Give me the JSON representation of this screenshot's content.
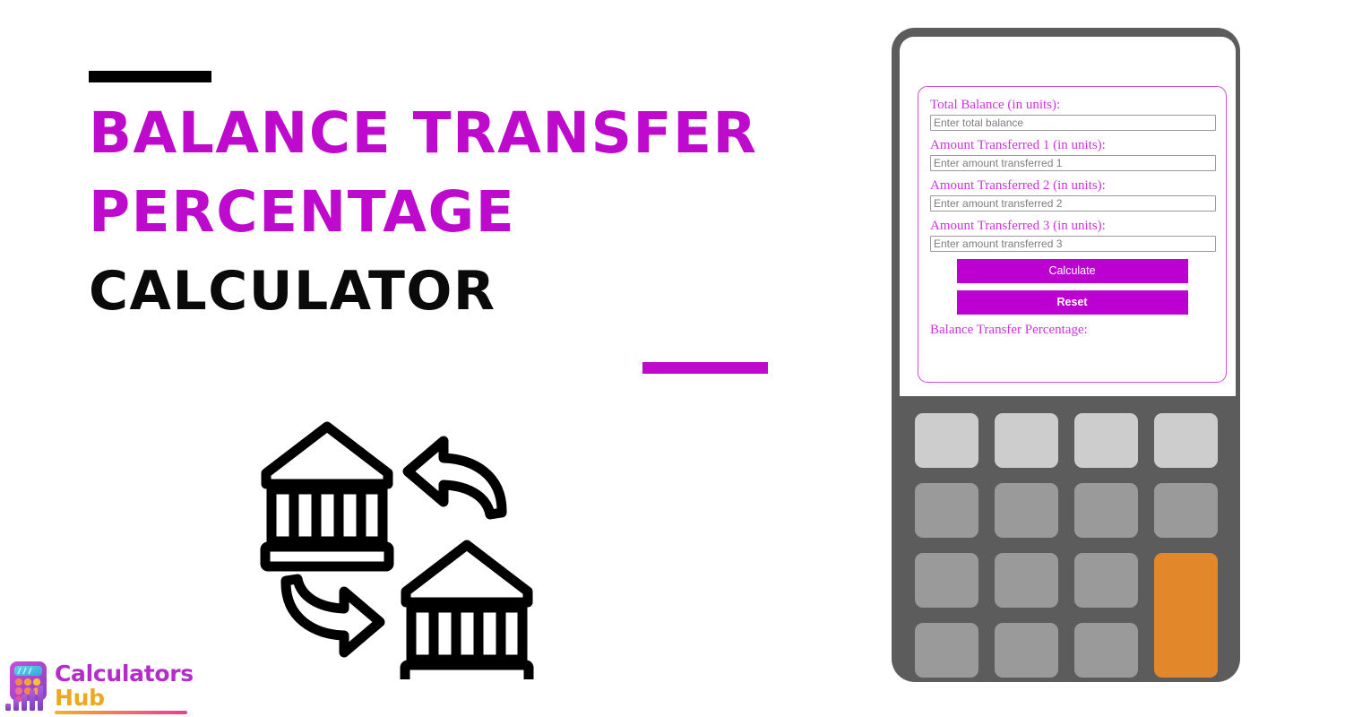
{
  "hero": {
    "title_lines": [
      {
        "text": "BALANCE TRANSFER",
        "color_class": "magenta"
      },
      {
        "text": "PERCENTAGE",
        "color_class": "magenta"
      },
      {
        "text": "CALCULATOR",
        "color_class": "black"
      }
    ],
    "accent_bar_top_color": "#000000",
    "accent_bar_bottom_color": "#bd0acd",
    "illustration_name": "bank-transfer-illustration"
  },
  "brand": {
    "word_1": "Calculators",
    "word_2": "Hub",
    "word_1_color": "#b32ec9",
    "word_2_color": "#eda820",
    "logo_icon": "calculator-bar-chart-icon"
  },
  "calculator": {
    "device_color": "#5c5c5c",
    "accent_color": "#bd00d2",
    "fields": [
      {
        "label": "Total Balance (in units):",
        "placeholder": "Enter total balance",
        "value": "",
        "name": "total-balance-field"
      },
      {
        "label": "Amount Transferred 1 (in units):",
        "placeholder": "Enter amount transferred 1",
        "value": "",
        "name": "amount-transferred-1-field"
      },
      {
        "label": "Amount Transferred 2 (in units):",
        "placeholder": "Enter amount transferred 2",
        "value": "",
        "name": "amount-transferred-2-field"
      },
      {
        "label": "Amount Transferred 3 (in units):",
        "placeholder": "Enter amount transferred 3",
        "value": "",
        "name": "amount-transferred-3-field"
      }
    ],
    "calculate_label": "Calculate",
    "reset_label": "Reset",
    "result_label": "Balance Transfer Percentage:",
    "result_value": "",
    "keypad": {
      "rows": [
        [
          "light",
          "light",
          "light",
          "light"
        ],
        [
          "medium",
          "medium",
          "medium",
          "medium"
        ],
        [
          "medium",
          "medium",
          "medium",
          "accent"
        ],
        [
          "medium",
          "medium",
          "medium"
        ]
      ],
      "light_color": "#cdcdcd",
      "medium_color": "#9a9a9a",
      "accent_color": "#e2882b"
    }
  }
}
